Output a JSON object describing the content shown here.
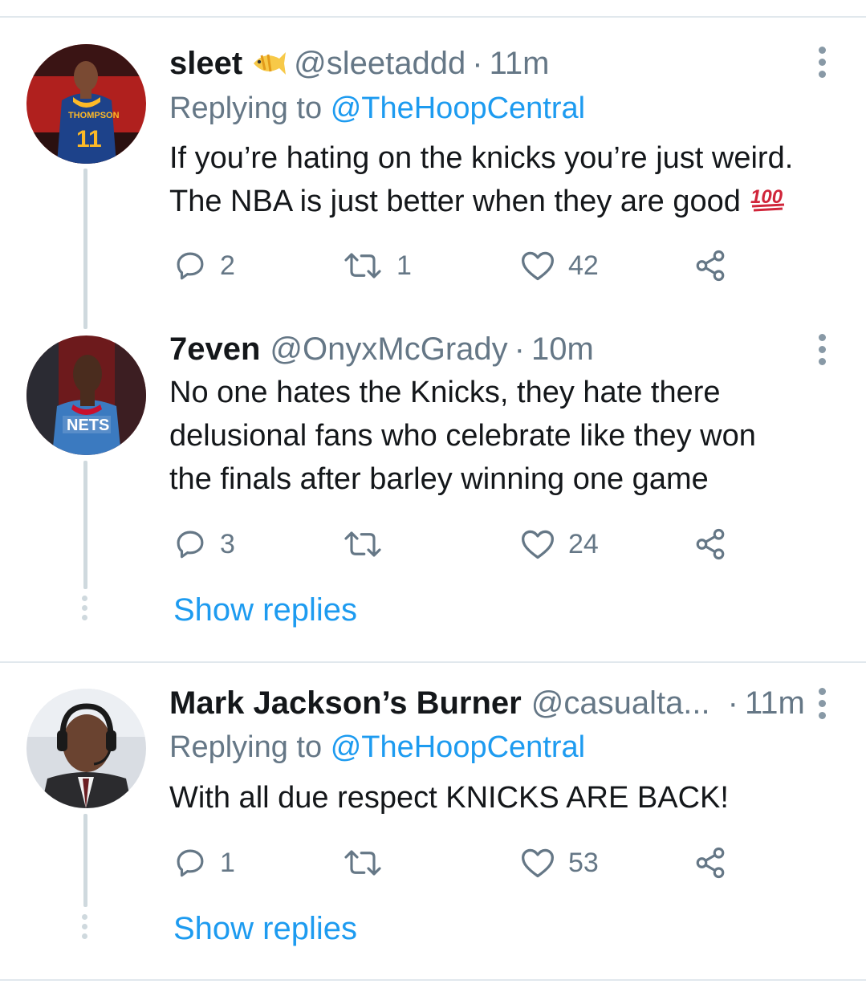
{
  "tweets": [
    {
      "name": "sleet",
      "has_emoji": "tropical-fish",
      "handle": "@sleetaddd",
      "separator": "·",
      "time": "11m",
      "replying_prefix": "Replying to",
      "replying_to": "@TheHoopCentral",
      "text_line1": "If you’re hating on the knicks you’re just weird.",
      "text_line2": "The NBA is just better when they are good",
      "text_emoji": "hundred-points",
      "replies": "2",
      "retweets": "1",
      "likes": "42"
    },
    {
      "name": "7even",
      "handle": "@OnyxMcGrady",
      "separator": "·",
      "time": "10m",
      "text_line1": "No one hates the Knicks, they hate there",
      "text_line2": "delusional fans who celebrate like they won",
      "text_line3": "the finals after barley winning one game",
      "replies": "3",
      "retweets": "",
      "likes": "24",
      "show_replies": "Show replies"
    },
    {
      "name": "Mark Jackson’s Burner",
      "handle": "@casualta...",
      "separator": "·",
      "time": "11m",
      "replying_prefix": "Replying to",
      "replying_to": "@TheHoopCentral",
      "text_line1": "With all due respect KNICKS ARE BACK!",
      "replies": "1",
      "retweets": "",
      "likes": "53",
      "show_replies": "Show replies"
    }
  ],
  "colors": {
    "link": "#1d9bf0",
    "muted": "#657786",
    "divider": "#e1e8ed",
    "thread": "#cfd9de"
  }
}
